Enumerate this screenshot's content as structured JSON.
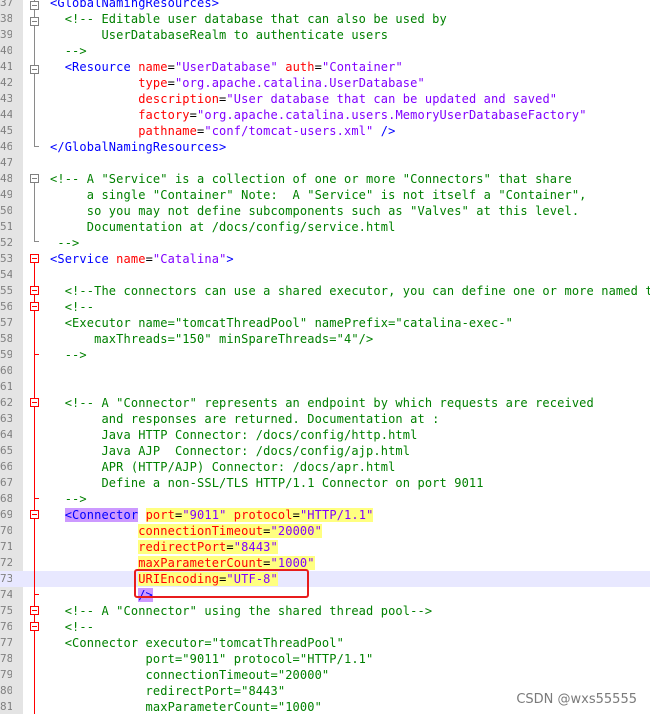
{
  "editor": {
    "language": "xml",
    "current_line_number": "73",
    "lines": [
      {
        "n": "37",
        "seg": [
          [
            "tag",
            "<GlobalNamingResources>"
          ]
        ]
      },
      {
        "n": "38",
        "seg": [
          [
            "com",
            "  <!-- Editable user database that can also be used by"
          ]
        ]
      },
      {
        "n": "39",
        "seg": [
          [
            "com",
            "       UserDatabaseRealm to authenticate users"
          ]
        ]
      },
      {
        "n": "40",
        "seg": [
          [
            "com",
            "  -->"
          ]
        ]
      },
      {
        "n": "41",
        "seg": [
          [
            "tag",
            "  <Resource "
          ],
          [
            "attr",
            "name"
          ],
          [
            "text",
            "="
          ],
          [
            "val",
            "\"UserDatabase\""
          ],
          [
            "text",
            " "
          ],
          [
            "attr",
            "auth"
          ],
          [
            "text",
            "="
          ],
          [
            "val",
            "\"Container\""
          ]
        ]
      },
      {
        "n": "42",
        "seg": [
          [
            "attr",
            "            type"
          ],
          [
            "text",
            "="
          ],
          [
            "val",
            "\"org.apache.catalina.UserDatabase\""
          ]
        ]
      },
      {
        "n": "43",
        "seg": [
          [
            "attr",
            "            description"
          ],
          [
            "text",
            "="
          ],
          [
            "val",
            "\"User database that can be updated and saved\""
          ]
        ]
      },
      {
        "n": "44",
        "seg": [
          [
            "attr",
            "            factory"
          ],
          [
            "text",
            "="
          ],
          [
            "val",
            "\"org.apache.catalina.users.MemoryUserDatabaseFactory\""
          ]
        ]
      },
      {
        "n": "45",
        "seg": [
          [
            "attr",
            "            pathname"
          ],
          [
            "text",
            "="
          ],
          [
            "val",
            "\"conf/tomcat-users.xml\""
          ],
          [
            "tag",
            " />"
          ]
        ]
      },
      {
        "n": "46",
        "seg": [
          [
            "tag",
            "</GlobalNamingResources>"
          ]
        ]
      },
      {
        "n": "47",
        "seg": []
      },
      {
        "n": "48",
        "seg": [
          [
            "com",
            "<!-- A \"Service\" is a collection of one or more \"Connectors\" that share"
          ]
        ]
      },
      {
        "n": "49",
        "seg": [
          [
            "com",
            "     a single \"Container\" Note:  A \"Service\" is not itself a \"Container\","
          ]
        ]
      },
      {
        "n": "50",
        "seg": [
          [
            "com",
            "     so you may not define subcomponents such as \"Valves\" at this level."
          ]
        ]
      },
      {
        "n": "51",
        "seg": [
          [
            "com",
            "     Documentation at /docs/config/service.html"
          ]
        ]
      },
      {
        "n": "52",
        "seg": [
          [
            "com",
            " -->"
          ]
        ]
      },
      {
        "n": "53",
        "seg": [
          [
            "tag",
            "<Service "
          ],
          [
            "attr",
            "name"
          ],
          [
            "text",
            "="
          ],
          [
            "val",
            "\"Catalina\""
          ],
          [
            "tag",
            ">"
          ]
        ]
      },
      {
        "n": "54",
        "seg": []
      },
      {
        "n": "55",
        "seg": [
          [
            "com",
            "  <!--The connectors can use a shared executor, you can define one or more named thread pools-->"
          ]
        ]
      },
      {
        "n": "56",
        "seg": [
          [
            "com",
            "  <!--"
          ]
        ]
      },
      {
        "n": "57",
        "seg": [
          [
            "com",
            "  <Executor name=\"tomcatThreadPool\" namePrefix=\"catalina-exec-\""
          ]
        ]
      },
      {
        "n": "58",
        "seg": [
          [
            "com",
            "      maxThreads=\"150\" minSpareThreads=\"4\"/>"
          ]
        ]
      },
      {
        "n": "59",
        "seg": [
          [
            "com",
            "  -->"
          ]
        ]
      },
      {
        "n": "60",
        "seg": []
      },
      {
        "n": "61",
        "seg": []
      },
      {
        "n": "62",
        "seg": [
          [
            "com",
            "  <!-- A \"Connector\" represents an endpoint by which requests are received"
          ]
        ]
      },
      {
        "n": "63",
        "seg": [
          [
            "com",
            "       and responses are returned. Documentation at :"
          ]
        ]
      },
      {
        "n": "64",
        "seg": [
          [
            "com",
            "       Java HTTP Connector: /docs/config/http.html"
          ]
        ]
      },
      {
        "n": "65",
        "seg": [
          [
            "com",
            "       Java AJP  Connector: /docs/config/ajp.html"
          ]
        ]
      },
      {
        "n": "66",
        "seg": [
          [
            "com",
            "       APR (HTTP/AJP) Connector: /docs/apr.html"
          ]
        ]
      },
      {
        "n": "67",
        "seg": [
          [
            "com",
            "       Define a non-SSL/TLS HTTP/1.1 Connector on port 9011"
          ]
        ]
      },
      {
        "n": "68",
        "seg": [
          [
            "com",
            "  -->"
          ]
        ]
      },
      {
        "n": "69",
        "seg": [
          [
            "text",
            "  "
          ],
          [
            "tag",
            "<Connector",
            "m"
          ],
          [
            "text",
            " "
          ],
          [
            "attr",
            "port",
            "h"
          ],
          [
            "text",
            "=",
            "h"
          ],
          [
            "val",
            "\"9011\"",
            "h"
          ],
          [
            "text",
            " ",
            "h"
          ],
          [
            "attr",
            "protocol",
            "h"
          ],
          [
            "text",
            "=",
            "h"
          ],
          [
            "val",
            "\"HTTP/1.1\"",
            "h"
          ]
        ]
      },
      {
        "n": "70",
        "seg": [
          [
            "text",
            "            "
          ],
          [
            "attr",
            "connectionTimeout",
            "h"
          ],
          [
            "text",
            "=",
            "h"
          ],
          [
            "val",
            "\"20000\"",
            "h"
          ]
        ]
      },
      {
        "n": "71",
        "seg": [
          [
            "text",
            "            "
          ],
          [
            "attr",
            "redirectPort",
            "h"
          ],
          [
            "text",
            "=",
            "h"
          ],
          [
            "val",
            "\"8443\"",
            "h"
          ]
        ]
      },
      {
        "n": "72",
        "seg": [
          [
            "text",
            "            "
          ],
          [
            "attr",
            "maxParameterCount",
            "h"
          ],
          [
            "text",
            "=",
            "h"
          ],
          [
            "val",
            "\"1000\"",
            "h"
          ]
        ]
      },
      {
        "n": "73",
        "seg": [
          [
            "text",
            "            "
          ],
          [
            "attr",
            "URIEncoding",
            "h"
          ],
          [
            "text",
            "=",
            "h"
          ],
          [
            "val",
            "\"UTF-8\"",
            "h"
          ]
        ]
      },
      {
        "n": "74",
        "seg": [
          [
            "text",
            "            "
          ],
          [
            "tag",
            "/>",
            "m"
          ]
        ]
      },
      {
        "n": "75",
        "seg": [
          [
            "com",
            "  <!-- A \"Connector\" using the shared thread pool-->"
          ]
        ]
      },
      {
        "n": "76",
        "seg": [
          [
            "com",
            "  <!--"
          ]
        ]
      },
      {
        "n": "77",
        "seg": [
          [
            "com",
            "  <Connector executor=\"tomcatThreadPool\""
          ]
        ]
      },
      {
        "n": "78",
        "seg": [
          [
            "com",
            "             port=\"9011\" protocol=\"HTTP/1.1\""
          ]
        ]
      },
      {
        "n": "79",
        "seg": [
          [
            "com",
            "             connectionTimeout=\"20000\""
          ]
        ]
      },
      {
        "n": "80",
        "seg": [
          [
            "com",
            "             redirectPort=\"8443\""
          ]
        ]
      },
      {
        "n": "81",
        "seg": [
          [
            "com",
            "             maxParameterCount=\"1000\""
          ]
        ]
      }
    ]
  },
  "colors": {
    "tag": "#0000ff",
    "attribute": "#ff0000",
    "value": "#8000ff",
    "comment": "#008000",
    "highlight": "#ffff80",
    "brace_match": "#cc99ff",
    "annotation_box": "#e81c1c"
  },
  "watermark": "CSDN @wxs55555"
}
